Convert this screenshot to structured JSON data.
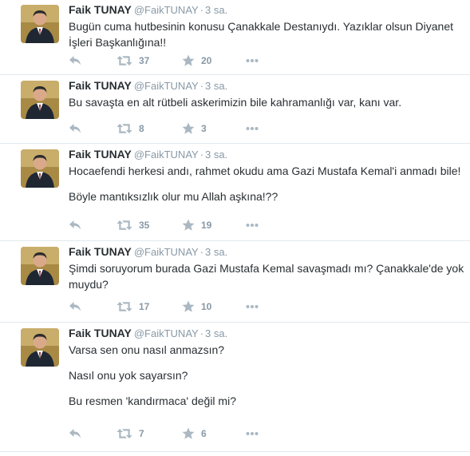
{
  "colors": {
    "name": "#292f33",
    "meta": "#8899a6",
    "icon": "#abb8c2",
    "divider": "#e1e8ed"
  },
  "tweets": [
    {
      "fullname": "Faik TUNAY",
      "username": "@FaikTUNAY",
      "separator": "·",
      "time": "3 sa.",
      "lines": [
        "Bugün cuma hutbesinin konusu Çanakkale Destanıydı. Yazıklar olsun Diyanet İşleri Başkanlığına!!"
      ],
      "retweets": "37",
      "favorites": "20"
    },
    {
      "fullname": "Faik TUNAY",
      "username": "@FaikTUNAY",
      "separator": "·",
      "time": "3 sa.",
      "lines": [
        "Bu savaşta en alt rütbeli askerimizin bile kahramanlığı var, kanı var."
      ],
      "retweets": "8",
      "favorites": "3"
    },
    {
      "fullname": "Faik TUNAY",
      "username": "@FaikTUNAY",
      "separator": "·",
      "time": "3 sa.",
      "lines": [
        "Hocaefendi herkesi andı, rahmet okudu ama Gazi Mustafa Kemal'i anmadı bile!",
        "Böyle mantıksızlık olur mu Allah aşkına!??"
      ],
      "retweets": "35",
      "favorites": "19"
    },
    {
      "fullname": "Faik TUNAY",
      "username": "@FaikTUNAY",
      "separator": "·",
      "time": "3 sa.",
      "lines": [
        "Şimdi soruyorum burada Gazi Mustafa Kemal savaşmadı mı? Çanakkale'de yok muydu?"
      ],
      "retweets": "17",
      "favorites": "10"
    },
    {
      "fullname": "Faik TUNAY",
      "username": "@FaikTUNAY",
      "separator": "·",
      "time": "3 sa.",
      "lines": [
        "Varsa sen onu nasıl anmazsın?",
        "Nasıl onu yok sayarsın?",
        "Bu resmen 'kandırmaca' değil mi?"
      ],
      "retweets": "7",
      "favorites": "6"
    }
  ]
}
